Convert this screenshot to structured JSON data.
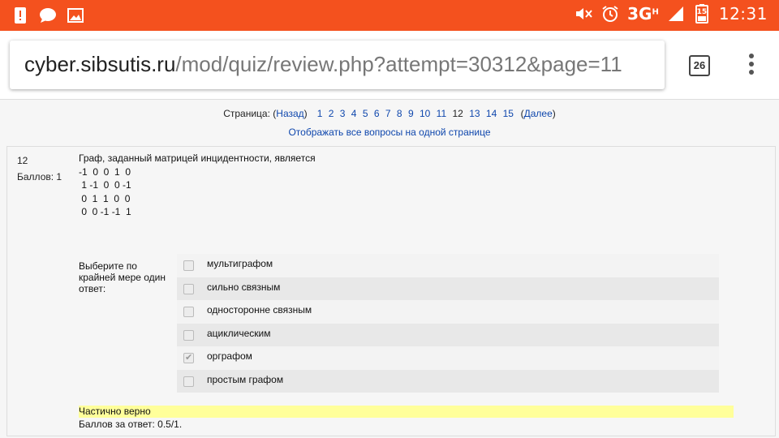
{
  "status_bar": {
    "network": "3G",
    "network_sup": "H",
    "battery": "15",
    "time": "12:31",
    "color": "#f4511e"
  },
  "browser": {
    "url_host": "cyber.sibsutis.ru",
    "url_path": "/mod/quiz/review.php?attempt=30312&page=11",
    "tab_count": "26"
  },
  "paging": {
    "label": "Страница: (",
    "prev": "Назад",
    "close_prev": ")",
    "pages": [
      "1",
      "2",
      "3",
      "4",
      "5",
      "6",
      "7",
      "8",
      "9",
      "10",
      "11",
      "12",
      "13",
      "14",
      "15"
    ],
    "current": "12",
    "open_next": "(",
    "next": "Далее",
    "close_next": ")",
    "show_all": "Отображать все вопросы на одной странице"
  },
  "question": {
    "number": "12",
    "points": "Баллов: 1",
    "text": "Граф, заданный матрицей инцидентности, является",
    "matrix": [
      "-1  0  0  1  0",
      " 1 -1  0  0 -1",
      " 0  1  1  0  0",
      " 0  0 -1 -1  1"
    ],
    "prompt": "Выберите по крайней мере один ответ:",
    "answers": [
      {
        "label": "мультиграфом",
        "checked": false
      },
      {
        "label": "сильно связным",
        "checked": false
      },
      {
        "label": "односторонне связным",
        "checked": false
      },
      {
        "label": "ациклическим",
        "checked": false
      },
      {
        "label": "орграфом",
        "checked": true
      },
      {
        "label": "простым графом",
        "checked": false
      }
    ],
    "feedback": "Частично верно",
    "mark": "Баллов за ответ: 0.5/1.",
    "feedback_color": "#ffff9a"
  }
}
